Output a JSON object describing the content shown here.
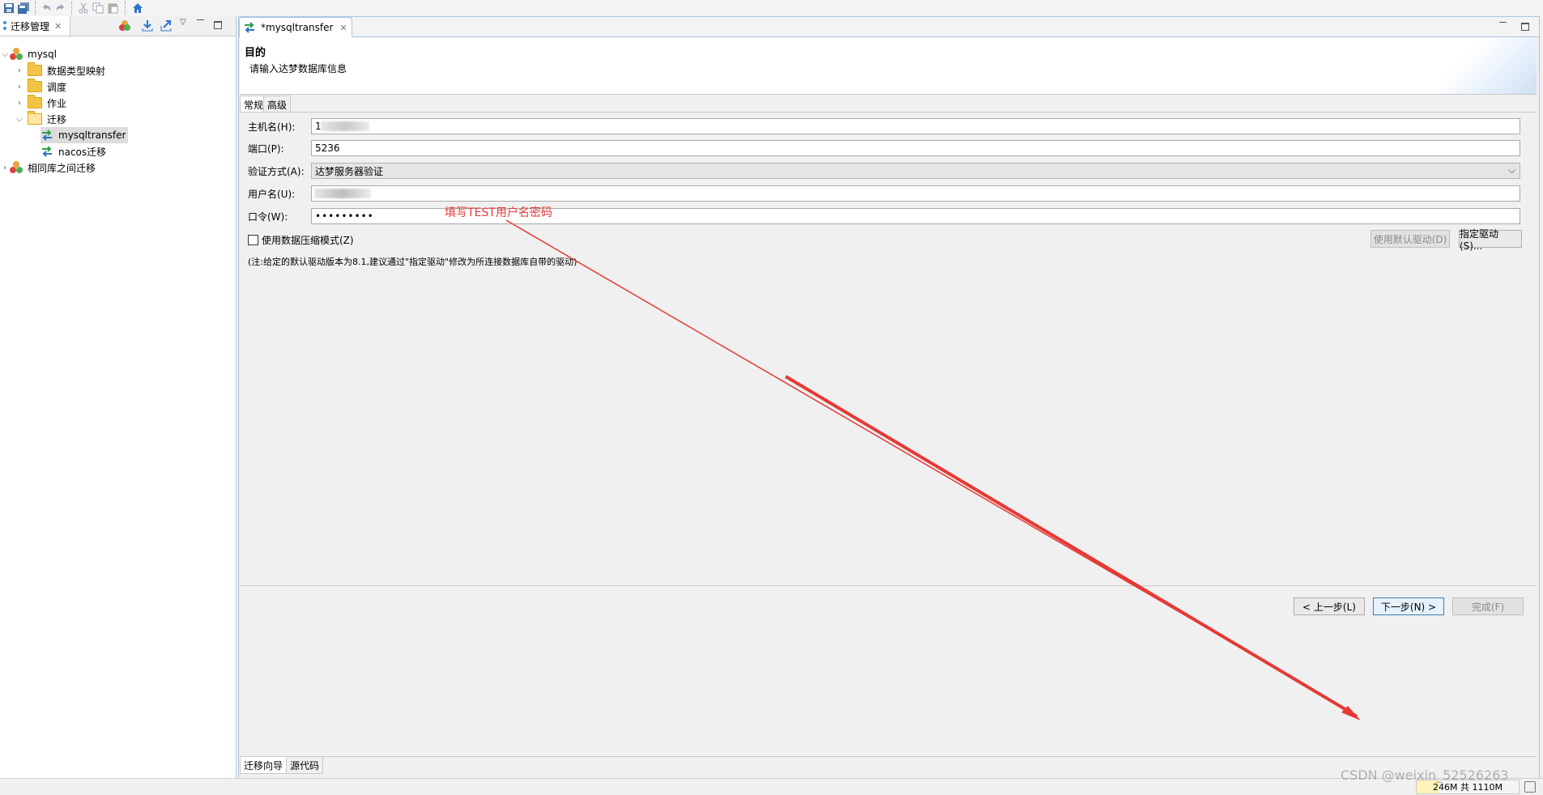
{
  "left_view": {
    "title": "迁移管理",
    "tree": [
      {
        "label": "mysql"
      },
      {
        "label": "数据类型映射"
      },
      {
        "label": "调度"
      },
      {
        "label": "作业"
      },
      {
        "label": "迁移"
      },
      {
        "label": "mysqltransfer"
      },
      {
        "label": "nacos迁移"
      },
      {
        "label": "相同库之间迁移"
      }
    ]
  },
  "editor": {
    "tab_title": "*mysqltransfer",
    "header": {
      "title": "目的",
      "description": "请输入达梦数据库信息"
    },
    "subtabs": [
      "常规",
      "高级"
    ],
    "form": {
      "host_label": "主机名(H):",
      "host_value": "1",
      "port_label": "端口(P):",
      "port_value": "5236",
      "auth_label": "验证方式(A):",
      "auth_value": "达梦服务器验证",
      "user_label": "用户名(U):",
      "user_value": "",
      "password_label": "口令(W):",
      "password_value": "•••••••••",
      "compress_label": "使用数据压缩模式(Z)",
      "default_driver_button": "使用默认驱动(D)",
      "specify_driver_button": "指定驱动(S)...",
      "note": "(注:给定的默认驱动版本为8.1,建议通过\"指定驱动\"修改为所连接数据库自带的驱动)"
    },
    "annotation": "填写TEST用户名密码",
    "buttons": {
      "back": "< 上一步(L)",
      "next": "下一步(N) >",
      "finish": "完成(F)"
    },
    "bottom_tabs": [
      "迁移向导",
      "源代码"
    ]
  },
  "status": {
    "memory": "246M 共 1110M",
    "watermark": "CSDN @weixin_52526263"
  },
  "colors": {
    "annotation_red": "#e53935",
    "editor_border": "#aac6e4"
  }
}
